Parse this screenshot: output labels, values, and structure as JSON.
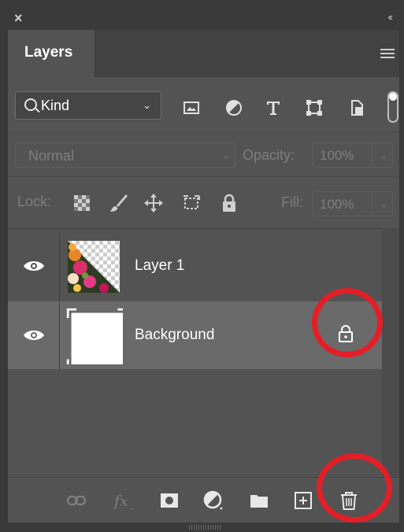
{
  "window": {
    "close_glyph": "×",
    "collapse_glyph": "‹‹"
  },
  "tabs": [
    {
      "label": "Layers",
      "active": true
    }
  ],
  "filter": {
    "kind_label": "Kind",
    "icons": [
      "image-filter-icon",
      "adjustment-filter-icon",
      "type-filter-icon",
      "shape-filter-icon",
      "smart-object-filter-icon"
    ]
  },
  "blend": {
    "mode": "Normal",
    "opacity_label": "Opacity:",
    "opacity_value": "100%"
  },
  "lock": {
    "label": "Lock:",
    "fill_label": "Fill:",
    "fill_value": "100%",
    "icons": [
      "lock-transparent-icon",
      "lock-image-icon",
      "lock-position-icon",
      "lock-artboard-icon",
      "lock-all-icon"
    ]
  },
  "layers": [
    {
      "name": "Layer 1",
      "visible": true,
      "selected": false,
      "locked": false
    },
    {
      "name": "Background",
      "visible": true,
      "selected": true,
      "locked": true
    }
  ],
  "bottom_icons": [
    "link-layers-icon",
    "fx-icon",
    "mask-icon",
    "adjustment-layer-icon",
    "group-folder-icon",
    "new-layer-icon",
    "delete-layer-icon"
  ],
  "colors": {
    "panel": "#535353",
    "chrome": "#3a3a3a",
    "selected_row": "#6a6a6a",
    "highlight_circle": "#e41e26"
  }
}
